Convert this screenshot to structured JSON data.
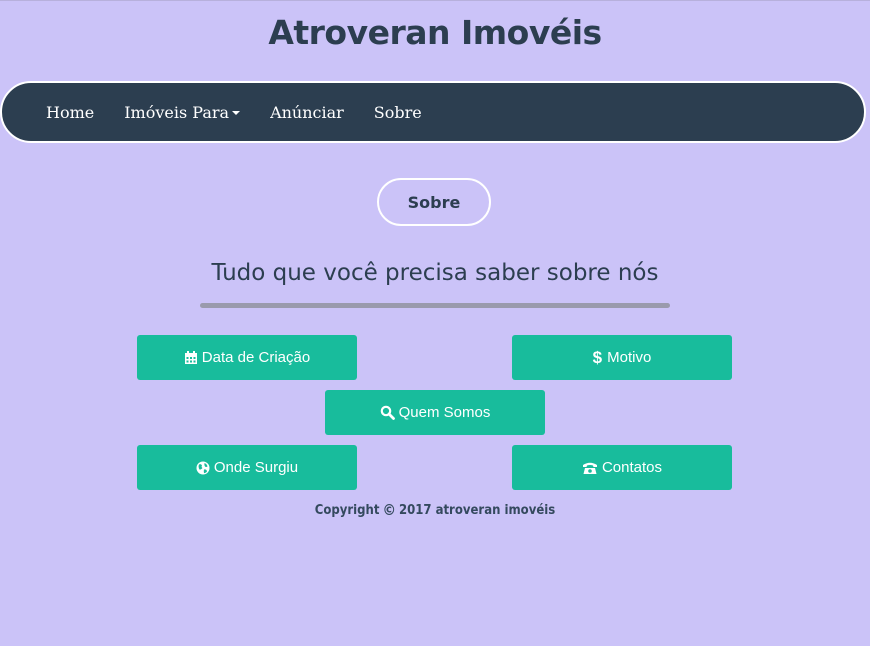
{
  "header": {
    "title": "Atroveran Imovéis"
  },
  "nav": {
    "items": [
      {
        "label": "Home"
      },
      {
        "label": "Imóveis Para"
      },
      {
        "label": "Anúnciar"
      },
      {
        "label": "Sobre"
      }
    ]
  },
  "main": {
    "section_label": "Sobre",
    "subtitle": "Tudo que você precisa saber sobre nós",
    "buttons": {
      "data_criacao": {
        "label": "Data de Criação",
        "icon": "calendar-icon"
      },
      "motivo": {
        "label": "Motivo",
        "icon": "dollar-icon"
      },
      "quem_somos": {
        "label": "Quem Somos",
        "icon": "search-icon"
      },
      "onde_surgiu": {
        "label": "Onde Surgiu",
        "icon": "globe-icon"
      },
      "contatos": {
        "label": "Contatos",
        "icon": "phone-icon"
      }
    }
  },
  "footer": {
    "prefix": "Copyright",
    "symbol": "©",
    "text": "2017 atroveran imovéis"
  },
  "colors": {
    "background": "#cbc3f8",
    "navbar": "#2c3e50",
    "button": "#18bc9c",
    "text_dark": "#2c3e50"
  }
}
